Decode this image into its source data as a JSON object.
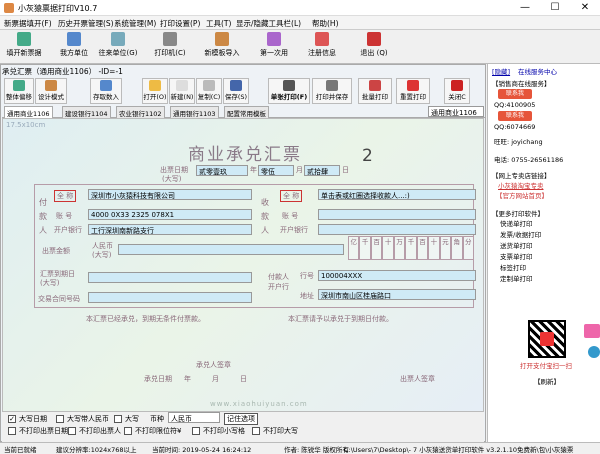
{
  "window": {
    "title": "小灰猿票据打印V10.7",
    "min": "—",
    "max": "☐",
    "close": "✕"
  },
  "menu": [
    "新票据填开(F)",
    "历史开票管理(S)",
    "系统管理(M)",
    "打印设置(P)",
    "工具(T)",
    "显示/隐藏工具栏(L)",
    "帮助(H)"
  ],
  "toolbar": [
    "填开新票据",
    "我方单位",
    "往来单位(G)",
    "打印机(C)",
    "新模板导入",
    "第一次用",
    "注册信息",
    "退出 (Q)"
  ],
  "sub": {
    "title": "承兑汇票（通用商业1106）  -ID=-1"
  },
  "subtools": [
    "整体偏移",
    "设计模式",
    "存取数入",
    "打开(O)",
    "新建(N)",
    "复制(C)",
    "保存(S)",
    "单张打印(F)",
    "打印并保存",
    "批量打印",
    "重置打印",
    "关闭C"
  ],
  "tabs": [
    "通用商业1106",
    "建设银行1104",
    "农业银行1102",
    "通用银行1103",
    "配置常用模板"
  ],
  "template_select": "通用商业1106",
  "watermark": "17.5x10cm",
  "bill": {
    "title": "商业承兑汇票",
    "number": "2",
    "issue_date_label": "出票日期",
    "issue_date_sub": "(大写)",
    "year": "贰零壹玖",
    "year_u": "年",
    "month": "零伍",
    "month_u": "月",
    "day": "贰拾肆",
    "day_u": "日",
    "payer_v": "付款人",
    "payee_v": "收款人",
    "full_name": "全 称",
    "account": "账 号",
    "bank": "开户银行",
    "payer_name": "深圳市小灰猿科技有限公司",
    "payer_account": "4000 0X33 2325 078X1",
    "payer_bank": "工行深圳南新路支行",
    "payee_name": "单击表或红圈选择收款人...:)",
    "amount_label": "出票金额",
    "amount_sub": "人民币\n(大写)",
    "digits": [
      "亿",
      "千",
      "百",
      "十",
      "万",
      "千",
      "百",
      "十",
      "元",
      "角",
      "分"
    ],
    "due_label": "汇票到期日\n(大写)",
    "contract_label": "交易合同号码",
    "drawee_label": "付款人开户行",
    "line_no": "行号",
    "line_no_val": "100004XXX",
    "addr": "地址",
    "addr_val": "深圳市南山区桂庙路口",
    "note1": "本汇票已经承兑，到期无条件付票款。",
    "note2": "本汇票请予以承兑于到期日付款。",
    "acceptor": "承兑人签章",
    "accept_date": "承兑日期",
    "year2": "年",
    "month2": "月",
    "day2": "日",
    "drawer": "出票人签章",
    "url": "www.xiaohuiyuan.com"
  },
  "bottom": {
    "upper_date": "大写日期",
    "upper_rmb": "大写带人民币",
    "upper_case": "大写",
    "currency": "币种",
    "currency_val": "人民币",
    "remember": "记住选项",
    "no_date": "不打印出票日期",
    "no_payer": "不打印出票人",
    "no_rmb": "不打印限位符¥",
    "no_small": "不打印小写格",
    "no_upper": "不打印大写"
  },
  "status": [
    "当前已就绪",
    "建议分辨率:1024x768以上",
    "当前时间: 2019-05-24 16:24:12",
    "作者: 陈锐华 版权所有",
    "C:\\Users\\7\\Desktop\\- 7 小灰猿送货单打印软件 v3.2.1.10免费新\\包\\小灰猿票"
  ],
  "side": {
    "hide": "[隐藏]",
    "online": "在线服务中心",
    "sales_hdr": "【销售商在线服务】",
    "qq1": "QQ:4100905",
    "qq2": "QQ:6074669",
    "contact": "联系我",
    "ww": "旺旺: joyichang",
    "phone": "电话: 0755-26561186",
    "shop_hdr": "【网上专卖店链接】",
    "shop1": "小灰猿淘宝专卖",
    "shop2": "【官方网站首页】",
    "more_hdr": "【更多打印软件】",
    "soft": [
      "快递单打印",
      "发票/收据打印",
      "送货单打印",
      "支票单打印",
      "标签打印",
      "定制单打印"
    ],
    "qr_text": "打开支付宝扫一扫",
    "refresh": "【刷新】"
  }
}
